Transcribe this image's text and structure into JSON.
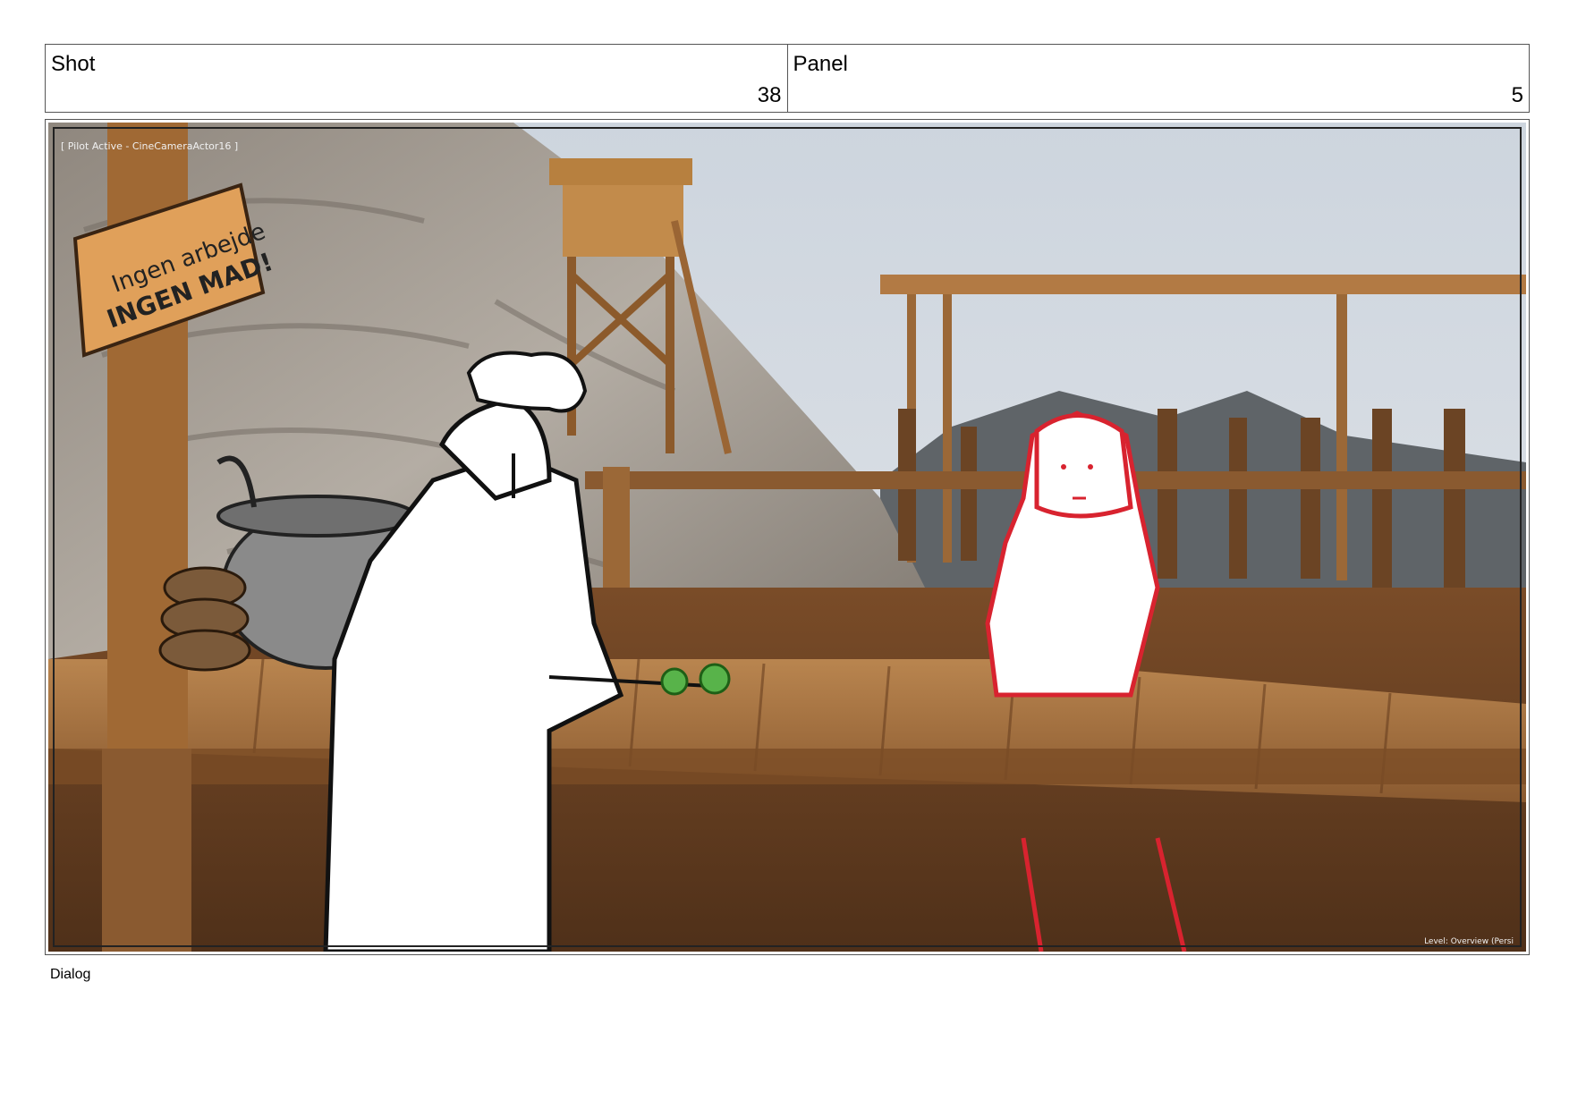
{
  "header": {
    "shot_label": "Shot",
    "shot_value": "38",
    "panel_label": "Panel",
    "panel_value": "5"
  },
  "frame": {
    "overlay_top_left": "[ Pilot Active - CineCameraActor16 ]",
    "overlay_bottom_right": "Level: Overview (Persi",
    "sign_line1": "Ingen arbejde",
    "sign_line2": "INGEN MAD!"
  },
  "footer": {
    "dialog_label": "Dialog"
  },
  "colors": {
    "wood": "#a8713f",
    "rock": "#9a9289",
    "sky": "#d5dbe2",
    "girl_outline": "#d8232f",
    "chef_fill": "#ffffff"
  }
}
